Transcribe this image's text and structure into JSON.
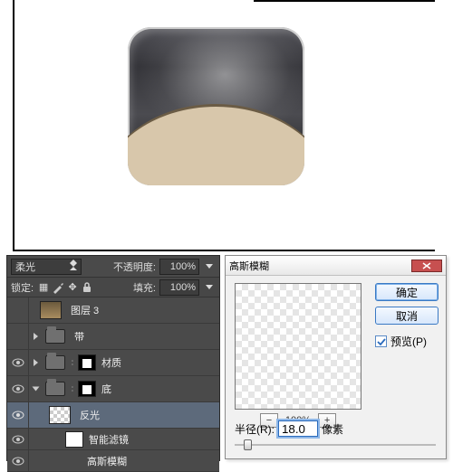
{
  "layers_panel": {
    "blend_mode": "柔光",
    "opacity_label": "不透明度:",
    "opacity_value": "100%",
    "lock_label": "锁定:",
    "fill_label": "填充:",
    "fill_value": "100%",
    "layers": [
      {
        "name": "图层 3",
        "visible": false,
        "type": "layer"
      },
      {
        "name": "带",
        "visible": false,
        "type": "group"
      },
      {
        "name": "材质",
        "visible": true,
        "type": "group"
      },
      {
        "name": "底",
        "visible": true,
        "type": "group"
      },
      {
        "name": "反光",
        "visible": true,
        "type": "layer",
        "selected": true
      },
      {
        "name": "智能滤镜",
        "visible": true,
        "type": "sub"
      },
      {
        "name": "高斯模糊",
        "visible": true,
        "type": "sub"
      }
    ]
  },
  "dialog": {
    "title": "高斯模糊",
    "ok": "确定",
    "cancel": "取消",
    "preview_label": "预览(P)",
    "preview_hotkey": "P",
    "preview_checked": true,
    "zoom": "100%",
    "radius_label": "半径(R):",
    "radius_hotkey": "R",
    "radius_value": "18.0",
    "radius_unit": "像素"
  }
}
